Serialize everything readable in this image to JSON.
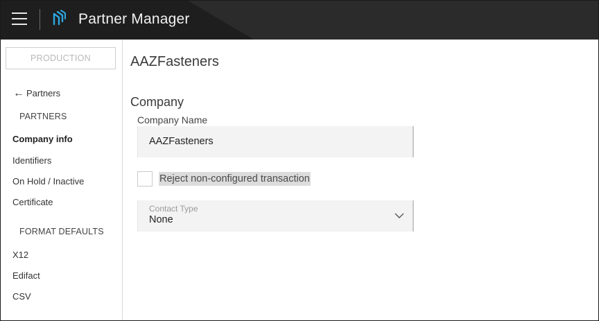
{
  "app": {
    "title": "Partner Manager",
    "menu_icon": "hamburger-menu-icon",
    "logo_icon": "partner-manager-logo-icon"
  },
  "sidebar": {
    "environment": "PRODUCTION",
    "back_label": "Partners",
    "partners_section": "PARTNERS",
    "items": [
      {
        "label": "Company info",
        "active": true
      },
      {
        "label": "Identifiers",
        "active": false
      },
      {
        "label": "On Hold / Inactive",
        "active": false
      },
      {
        "label": "Certificate",
        "active": false
      }
    ],
    "format_section": "FORMAT DEFAULTS",
    "format_items": [
      {
        "label": "X12"
      },
      {
        "label": "Edifact"
      },
      {
        "label": "CSV"
      }
    ]
  },
  "main": {
    "page_title": "AAZFasteners",
    "section_title": "Company",
    "company_name_label": "Company Name",
    "company_name_value": "AAZFasteners",
    "reject_checkbox_label": "Reject non-configured transaction",
    "reject_checked": false,
    "contact_type_placeholder": "Contact Type",
    "contact_type_value": "None"
  },
  "colors": {
    "topbar": "#1e1e1e",
    "logo_accent": "#2fa8e0",
    "field_bg": "#f3f3f3"
  }
}
